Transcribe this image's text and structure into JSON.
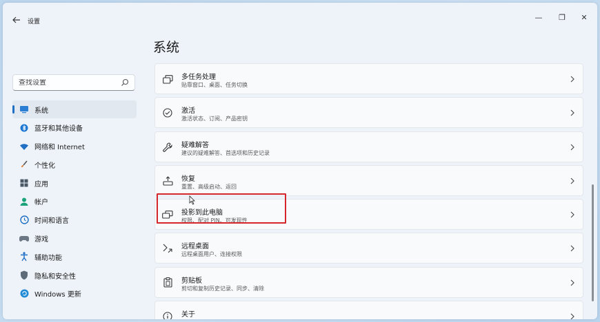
{
  "window": {
    "title": "设置",
    "back_icon": "arrow-left-icon",
    "controls": {
      "minimize": "—",
      "maximize": "❐",
      "close": "✕"
    }
  },
  "search": {
    "placeholder": "查找设置",
    "icon": "search-icon"
  },
  "nav": {
    "items": [
      {
        "label": "系统",
        "icon": "system-display-icon",
        "active": true
      },
      {
        "label": "蓝牙和其他设备",
        "icon": "bluetooth-icon"
      },
      {
        "label": "网络和 Internet",
        "icon": "wifi-icon"
      },
      {
        "label": "个性化",
        "icon": "brush-icon"
      },
      {
        "label": "应用",
        "icon": "apps-grid-icon"
      },
      {
        "label": "帐户",
        "icon": "account-icon"
      },
      {
        "label": "时间和语言",
        "icon": "globe-clock-icon"
      },
      {
        "label": "游戏",
        "icon": "gamepad-icon"
      },
      {
        "label": "辅助功能",
        "icon": "accessibility-icon"
      },
      {
        "label": "隐私和安全性",
        "icon": "shield-icon"
      },
      {
        "label": "Windows 更新",
        "icon": "windows-update-icon"
      }
    ]
  },
  "main": {
    "title": "系统",
    "cards": [
      {
        "title": "多任务处理",
        "subtitle": "贴靠窗口、桌面、任务切换",
        "icon": "multitask-icon"
      },
      {
        "title": "激活",
        "subtitle": "激活状态、订阅、产品密钥",
        "icon": "check-circle-icon"
      },
      {
        "title": "疑难解答",
        "subtitle": "建议的疑难解答、首选项和历史记录",
        "icon": "wrench-icon"
      },
      {
        "title": "恢复",
        "subtitle": "重置、高级启动、返回",
        "icon": "recovery-icon"
      },
      {
        "title": "投影到此电脑",
        "subtitle": "权限、配对 PIN、可发现性",
        "icon": "project-icon"
      },
      {
        "title": "远程桌面",
        "subtitle": "远程桌面用户、连接权限",
        "icon": "remote-desktop-icon"
      },
      {
        "title": "剪贴板",
        "subtitle": "剪切和复制历史记录、同步、清除",
        "icon": "clipboard-icon"
      },
      {
        "title": "关于",
        "subtitle": "",
        "icon": "info-icon"
      }
    ]
  },
  "colors": {
    "accent": "#1f6fc4",
    "highlight": "#d4252a"
  }
}
